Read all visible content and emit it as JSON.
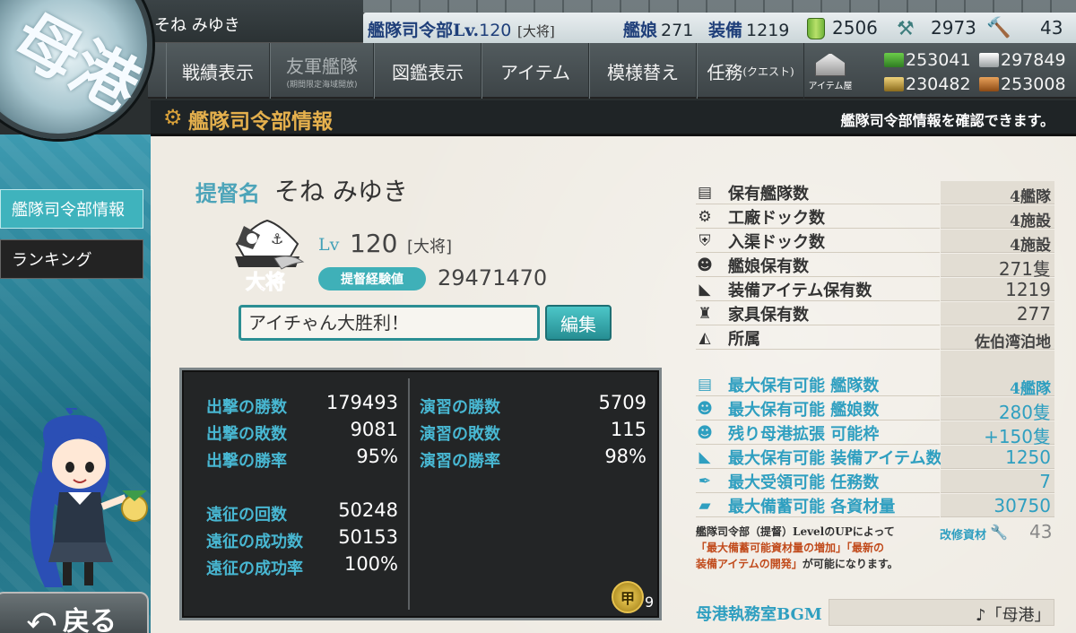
{
  "header": {
    "player_name": "そね みゆき",
    "hq_level_prefix": "艦隊司令部Lv.",
    "hq_level": "120",
    "hq_rank": "[大将]",
    "ships_label": "艦娘",
    "ships_value": "271",
    "equipment_label": "装備",
    "equipment_value": "1219",
    "bucket": "2506",
    "dev_material": "2973",
    "screw": "43"
  },
  "resources": {
    "fuel": "253041",
    "ammo": "297849",
    "steel": "230482",
    "bauxite": "253008"
  },
  "menu": {
    "record": "戦績表示",
    "friend_fleet": "友軍艦隊",
    "friend_fleet_sub": "(期間限定海域開放)",
    "library": "図鑑表示",
    "item": "アイテム",
    "furniture": "模様替え",
    "quest": "任務",
    "quest_sub": "(クエスト)",
    "shop": "アイテム屋"
  },
  "title": {
    "text": "艦隊司令部情報",
    "hint": "艦隊司令部情報を確認できます。"
  },
  "sidebar": {
    "items": [
      {
        "label": "艦隊司令部情報"
      },
      {
        "label": "ランキング"
      }
    ],
    "back": "戻る"
  },
  "profile": {
    "admiral_label": "提督名",
    "admiral_name": "そね みゆき",
    "rank_badge_text": "大将",
    "lv_label": "Lv",
    "level": "120",
    "rank": "[大将]",
    "exp_label": "提督経験値",
    "exp_value": "29471470",
    "comment": "アイチゃん大胜利！",
    "edit_label": "編集"
  },
  "battle_stats": {
    "sortie_wins_label": "出撃の勝数",
    "sortie_wins": "179493",
    "sortie_losses_label": "出撃の敗数",
    "sortie_losses": "9081",
    "sortie_rate_label": "出撃の勝率",
    "sortie_rate": "95%",
    "exercise_wins_label": "演習の勝数",
    "exercise_wins": "5709",
    "exercise_losses_label": "演習の敗数",
    "exercise_losses": "115",
    "exercise_rate_label": "演習の勝率",
    "exercise_rate": "98%",
    "expedition_count_label": "遠征の回数",
    "expedition_count": "50248",
    "expedition_success_label": "遠征の成功数",
    "expedition_success": "50153",
    "expedition_rate_label": "遠征の成功率",
    "expedition_rate": "100%",
    "medal_char": "甲",
    "medal_count": "9"
  },
  "info": {
    "rows": [
      {
        "label": "保有艦隊数",
        "value": "4艦隊",
        "icon": "fleet-icon"
      },
      {
        "label": "工廠ドック数",
        "value": "4施設",
        "icon": "gear-icon"
      },
      {
        "label": "入渠ドック数",
        "value": "4施設",
        "icon": "repair-dock-icon"
      },
      {
        "label": "艦娘保有数",
        "value": "271隻",
        "icon": "shipgirl-icon"
      },
      {
        "label": "装備アイテム保有数",
        "value": "1219",
        "icon": "equipment-icon"
      },
      {
        "label": "家具保有数",
        "value": "277",
        "icon": "furniture-icon"
      },
      {
        "label": "所属",
        "value": "佐伯湾泊地",
        "icon": "base-icon"
      }
    ],
    "max_rows": [
      {
        "label": "最大保有可能 艦隊数",
        "value": "4艦隊",
        "icon": "fleet-icon"
      },
      {
        "label": "最大保有可能 艦娘数",
        "value": "280隻",
        "icon": "shipgirl-icon"
      },
      {
        "label": "残り母港拡張 可能枠",
        "value": "+150隻",
        "icon": "expansion-icon"
      },
      {
        "label": "最大保有可能 装備アイテム数",
        "value": "1250",
        "icon": "equipment-icon"
      },
      {
        "label": "最大受領可能 任務数",
        "value": "7",
        "icon": "quest-feather-icon"
      },
      {
        "label": "最大備蓄可能 各資材量",
        "value": "30750",
        "icon": "storage-icon"
      }
    ],
    "note_line1": "艦隊司令部（提督）LevelのUPによって",
    "note_line2": "「最大備蓄可能資材量の増加」「最新の",
    "note_line3": "装備アイテムの開発」",
    "note_line3b": "が可能になります。",
    "repair_label": "改修資材",
    "repair_value": "43",
    "bgm_label": "母港執務室BGM",
    "bgm_value": "♪「母港」"
  },
  "colors": {
    "accent_cyan": "#2f9fc0",
    "title_gold": "#e5b04d",
    "panel_dark": "#232526"
  }
}
